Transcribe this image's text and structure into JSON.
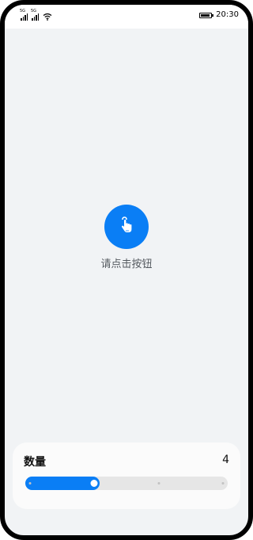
{
  "status_bar": {
    "time": "20:30",
    "signal_labels": [
      "5G",
      "5G"
    ],
    "icons": [
      "signal-icon",
      "signal-icon",
      "wifi-icon",
      "battery-icon"
    ],
    "battery_level": 0.9
  },
  "main": {
    "button_icon": "tap-hand-icon",
    "prompt_text": "请点击按钮"
  },
  "quantity_card": {
    "label": "数量",
    "value": "4",
    "slider": {
      "min": 1,
      "max": 10,
      "value": 4,
      "steps": 4
    }
  },
  "colors": {
    "accent": "#0a7ef5",
    "background": "#f1f3f5",
    "card": "#fbfbfb",
    "track": "#e6e6e6"
  }
}
